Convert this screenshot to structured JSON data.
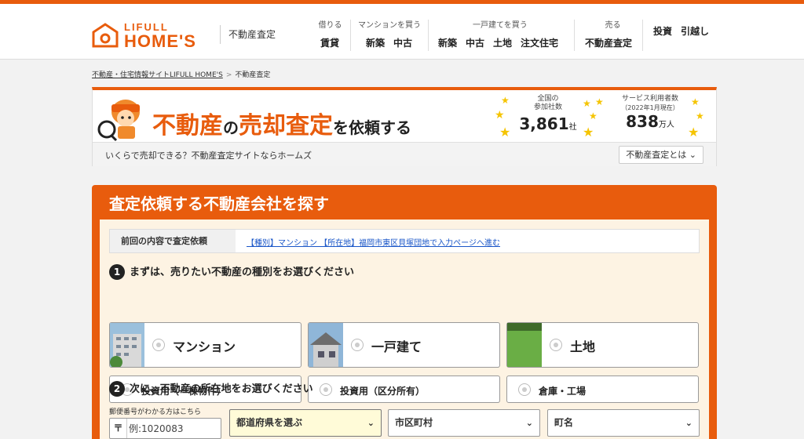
{
  "header": {
    "logo_top": "LIFULL",
    "logo_bottom": "HOME'S",
    "site_sub": "不動産査定",
    "nav": [
      {
        "title": "借りる",
        "items": [
          "賃貸"
        ]
      },
      {
        "title": "マンションを買う",
        "items": [
          "新築",
          "中古"
        ]
      },
      {
        "title": "一戸建てを買う",
        "items": [
          "新築",
          "中古",
          "土地",
          "注文住宅"
        ]
      },
      {
        "title": "売る",
        "items": [
          "不動産査定"
        ]
      },
      {
        "title": "",
        "items": [
          "投資",
          "引越し"
        ]
      }
    ]
  },
  "breadcrumb": {
    "home": "不動産・住宅情報サイトLIFULL HOME'S",
    "sep": ">",
    "current": "不動産査定"
  },
  "banner": {
    "title_part1": "不動産",
    "title_part2": "の",
    "title_part3": "売却査定",
    "title_part4": "を依頼する",
    "stat1_label1": "全国の",
    "stat1_label2": "参加社数",
    "stat1_value": "3,861",
    "stat1_unit": "社",
    "stat2_label1": "サービス利用者数",
    "stat2_label2": "（2022年1月現在）",
    "stat2_value": "838",
    "stat2_unit": "万人",
    "foot_text": "いくらで売却できる？不動産査定サイトならホームズ",
    "foot_button": "不動産査定とは"
  },
  "panel": {
    "title": "査定依頼する不動産会社を探す",
    "prev_key": "前回の内容で査定依頼",
    "prev_value": "【種別】マンション 【所在地】福岡市東区貝塚団地で入力ページへ進む",
    "step1_num": "1",
    "step1_text": "まずは、売りたい不動産の種別をお選びください",
    "types_big": [
      "マンション",
      "一戸建て",
      "土地"
    ],
    "types_small": [
      "投資用（一棟物件）",
      "投資用（区分所有）",
      "倉庫・工場"
    ],
    "step2_num": "2",
    "step2_text": "次に、不動産の所在地をお選びください",
    "zip_label": "郵便番号がわかる方はこちら",
    "zip_mark": "〒",
    "zip_placeholder": "例:1020083",
    "pref_select": "都道府県を選ぶ",
    "city_select": "市区町村",
    "town_select": "町名"
  },
  "colors": {
    "accent": "#e85c0d",
    "link": "#1a56c8",
    "star": "#f5c400"
  }
}
